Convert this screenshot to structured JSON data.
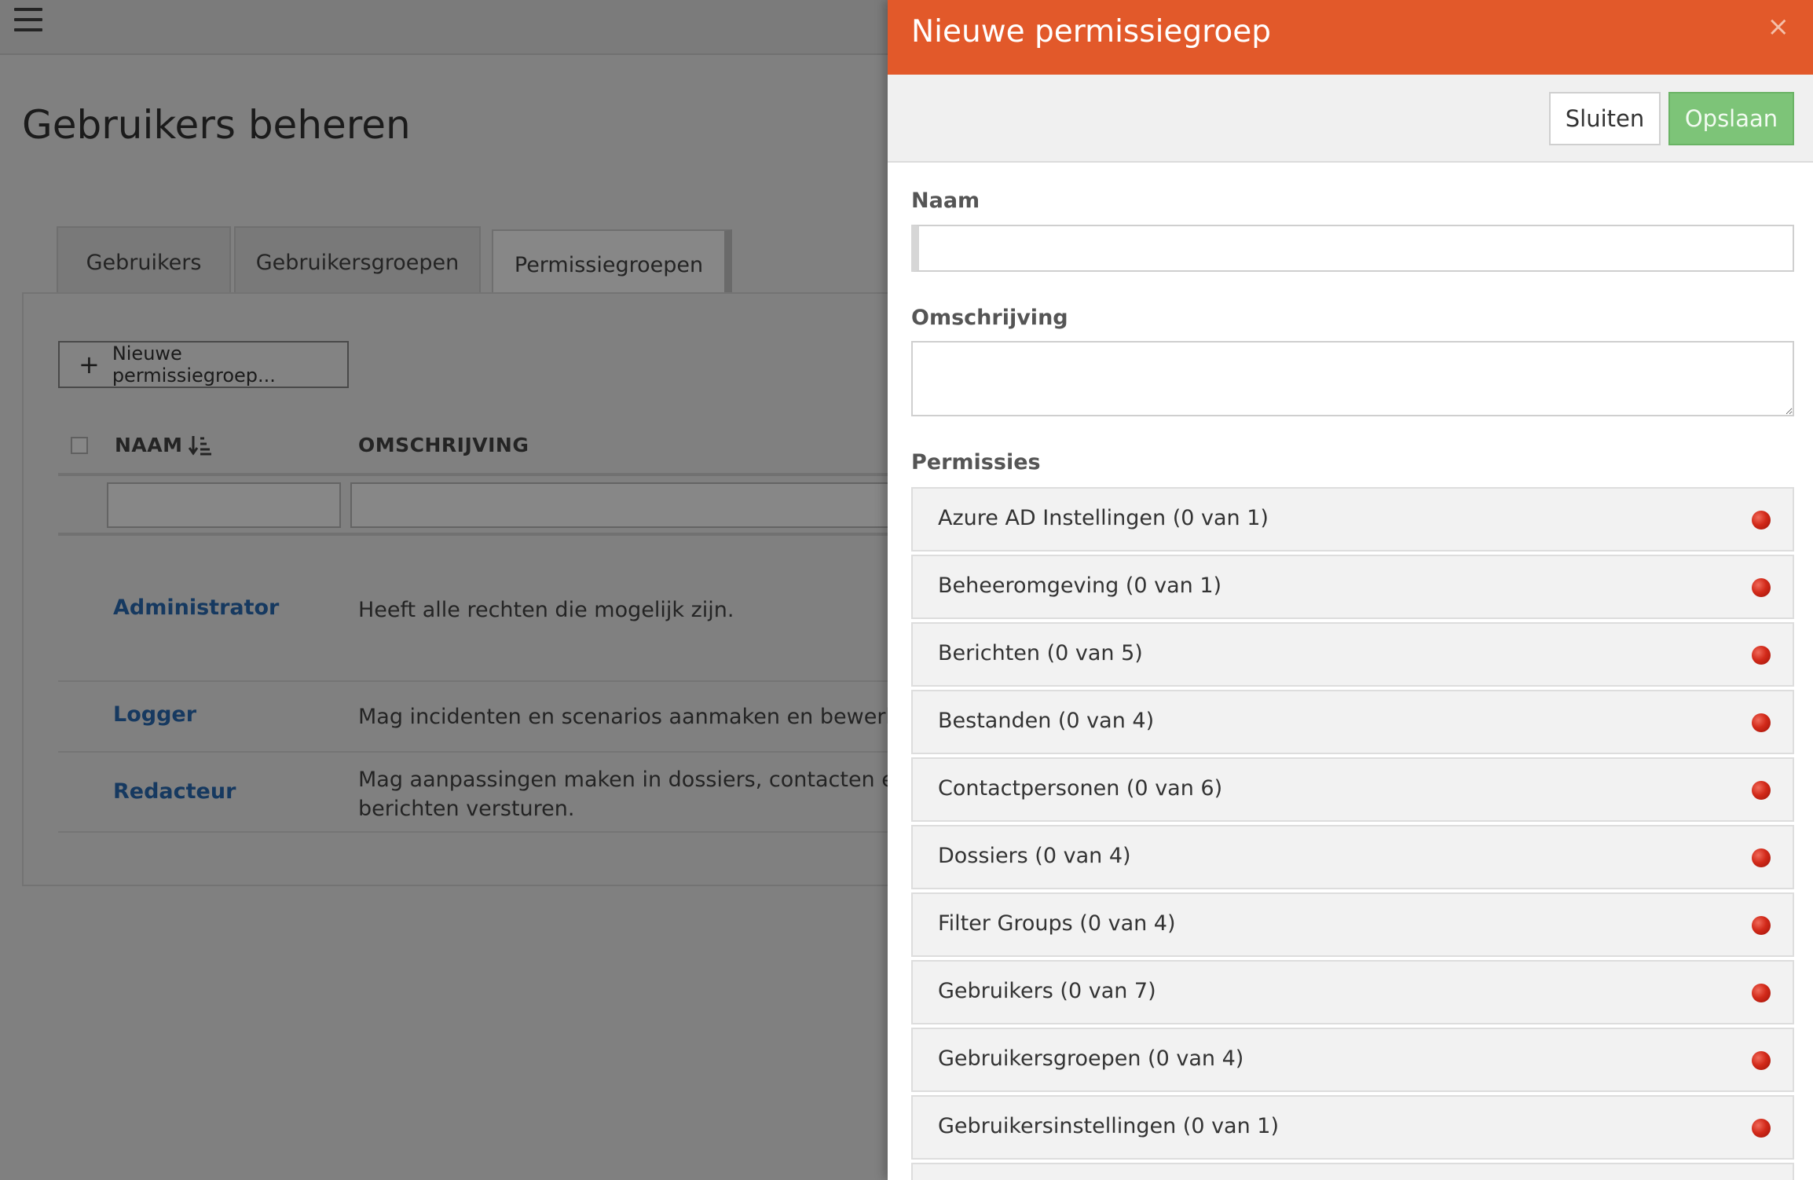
{
  "page": {
    "title": "Gebruikers beheren",
    "tabs": [
      {
        "label": "Gebruikers"
      },
      {
        "label": "Gebruikersgroepen"
      },
      {
        "label": "Permissiegroepen"
      }
    ],
    "new_button": {
      "label": "Nieuwe permissiegroep..."
    },
    "table": {
      "headers": {
        "name": "NAAM",
        "description": "OMSCHRIJVING"
      },
      "rows": [
        {
          "name": "Administrator",
          "description_lines": [
            "Heeft alle rechten die mogelijk zijn."
          ]
        },
        {
          "name": "Logger",
          "description_lines": [
            "Mag incidenten en scenarios aanmaken en bewerken."
          ]
        },
        {
          "name": "Redacteur",
          "description_lines": [
            "Mag aanpassingen maken in dossiers, contacten en best",
            "berichten versturen."
          ]
        }
      ]
    }
  },
  "panel": {
    "title": "Nieuwe permissiegroep",
    "close_symbol": "×",
    "buttons": {
      "close": "Sluiten",
      "save": "Opslaan"
    },
    "fields": {
      "name_label": "Naam",
      "name_value": "",
      "description_label": "Omschrijving",
      "description_value": "",
      "permissions_label": "Permissies"
    },
    "permissions": [
      {
        "label": "Azure AD Instellingen (0 van 1)"
      },
      {
        "label": "Beheeromgeving (0 van 1)"
      },
      {
        "label": "Berichten (0 van 5)"
      },
      {
        "label": "Bestanden (0 van 4)"
      },
      {
        "label": "Contactpersonen (0 van 6)"
      },
      {
        "label": "Dossiers (0 van 4)"
      },
      {
        "label": "Filter Groups (0 van 4)"
      },
      {
        "label": "Gebruikers (0 van 7)"
      },
      {
        "label": "Gebruikersgroepen (0 van 4)"
      },
      {
        "label": "Gebruikersinstellingen (0 van 1)"
      }
    ],
    "status_indicator_color": "#d22a1a"
  },
  "colors": {
    "header_accent": "#e2592a",
    "save_button": "#7dc478",
    "link": "#2a6db5"
  },
  "icons": {
    "menu": "hamburger-icon",
    "plus": "plus-icon",
    "sort": "sort-ascending-icon",
    "close": "close-icon",
    "status": "red-status-dot-icon"
  }
}
